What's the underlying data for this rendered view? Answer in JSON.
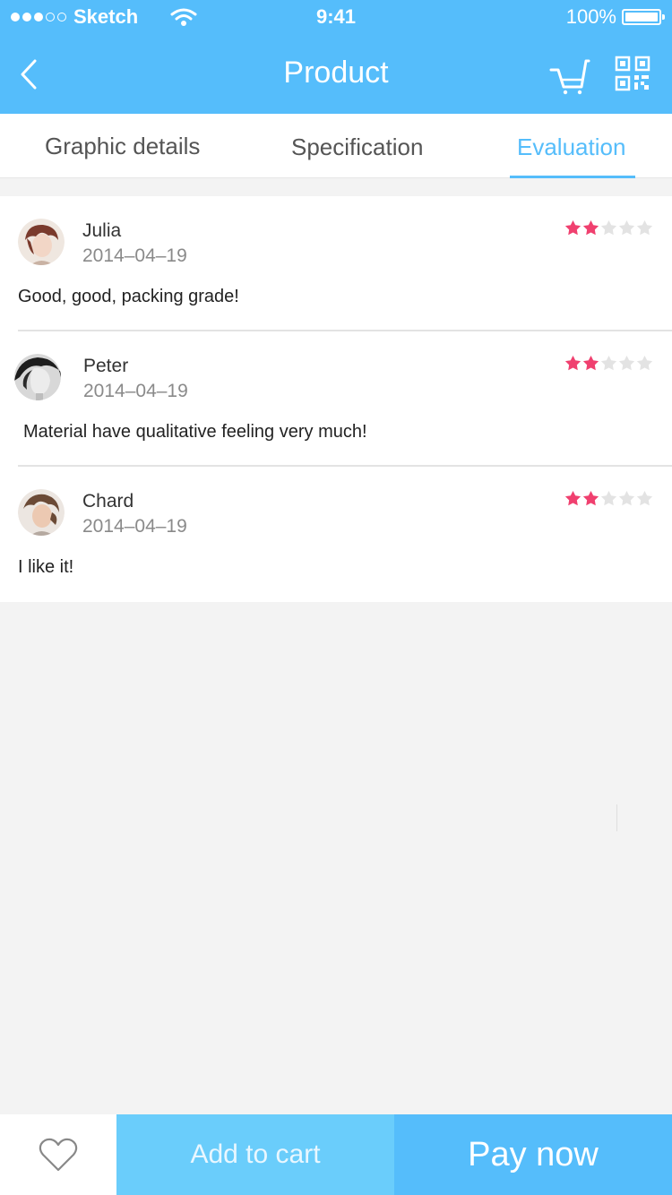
{
  "status_bar": {
    "carrier": "Sketch",
    "time": "9:41",
    "battery": "100%",
    "battery_level": 1.0,
    "signal_bars": 3
  },
  "nav": {
    "title": "Product",
    "icons": [
      "back-icon",
      "cart-icon",
      "qr-code-icon"
    ]
  },
  "tabs": [
    {
      "label": "Graphic details",
      "active": false
    },
    {
      "label": "Specification",
      "active": false
    },
    {
      "label": "Evaluation",
      "active": true
    }
  ],
  "reviews": [
    {
      "name": "Julia",
      "date": "2014–04–19",
      "comment": "Good, good, packing grade!",
      "rating": 2,
      "max_rating": 5
    },
    {
      "name": "Peter",
      "date": "2014–04–19",
      "comment": "Material have qualitative feeling very much!",
      "rating": 2,
      "max_rating": 5
    },
    {
      "name": "Chard",
      "date": "2014–04–19",
      "comment": "I like it!",
      "rating": 2,
      "max_rating": 5
    }
  ],
  "bottom_bar": {
    "favorite_icon": "heart-icon",
    "add_to_cart": "Add to cart",
    "pay_now": "Pay now"
  },
  "colors": {
    "primary": "#55bdfb",
    "secondary": "#6acdfb",
    "star_active": "#f0406f",
    "star_inactive": "#e3e3e3"
  }
}
